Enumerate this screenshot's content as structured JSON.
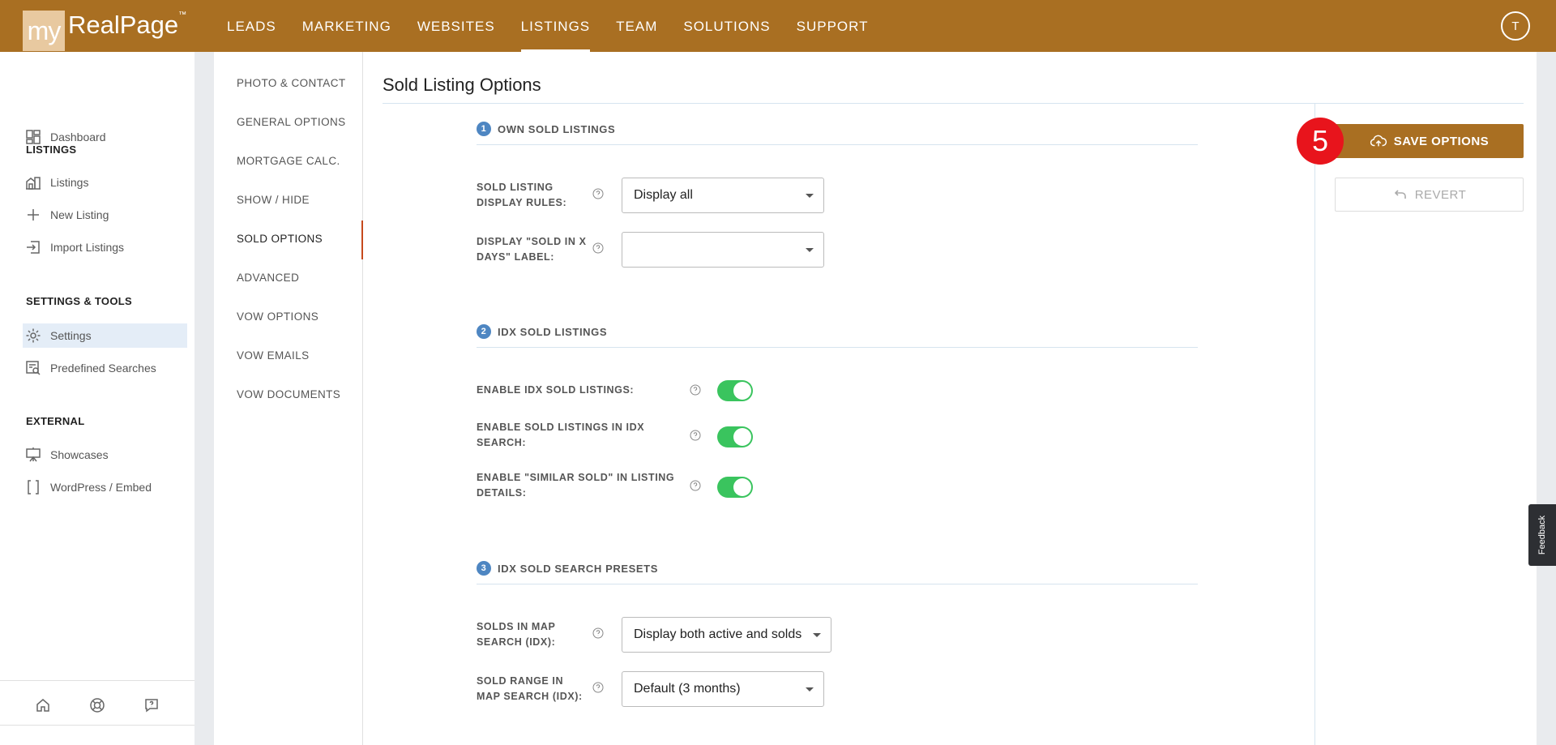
{
  "header": {
    "logo_my": "my",
    "logo_rest": "RealPage",
    "logo_tm": "™",
    "nav": [
      "LEADS",
      "MARKETING",
      "WEBSITES",
      "LISTINGS",
      "TEAM",
      "SOLUTIONS",
      "SUPPORT"
    ],
    "active_nav": "LISTINGS",
    "avatar_initial": "T"
  },
  "sidebar": {
    "dashboard": "Dashboard",
    "listings_title": "LISTINGS",
    "listings": "Listings",
    "new_listing": "New Listing",
    "import_listings": "Import Listings",
    "settings_title": "SETTINGS & TOOLS",
    "settings": "Settings",
    "predefined_searches": "Predefined Searches",
    "external_title": "EXTERNAL",
    "showcases": "Showcases",
    "wordpress": "WordPress / Embed"
  },
  "subnav": {
    "items": [
      "PHOTO & CONTACT",
      "GENERAL OPTIONS",
      "MORTGAGE CALC.",
      "SHOW / HIDE",
      "SOLD OPTIONS",
      "ADVANCED",
      "VOW OPTIONS",
      "VOW EMAILS",
      "VOW DOCUMENTS"
    ],
    "active": "SOLD OPTIONS"
  },
  "main": {
    "title": "Sold Listing Options",
    "section1": {
      "num": "1",
      "title": "OWN SOLD LISTINGS",
      "display_rules_label_1": "SOLD LISTING",
      "display_rules_label_2": "DISPLAY RULES:",
      "display_rules_value": "Display all",
      "sold_days_label_1": "DISPLAY \"SOLD IN X",
      "sold_days_label_2": "DAYS\" LABEL:",
      "sold_days_value": ""
    },
    "section2": {
      "num": "2",
      "title": "IDX SOLD LISTINGS",
      "enable_idx_sold": "ENABLE IDX SOLD LISTINGS:",
      "enable_in_search_1": "ENABLE SOLD LISTINGS IN IDX",
      "enable_in_search_2": "SEARCH:",
      "enable_similar_1": "ENABLE \"SIMILAR SOLD\" IN LISTING",
      "enable_similar_2": "DETAILS:"
    },
    "section3": {
      "num": "3",
      "title": "IDX SOLD SEARCH PRESETS",
      "map_search_label_1": "SOLDS IN MAP",
      "map_search_label_2": "SEARCH (IDX):",
      "map_search_value": "Display both active and solds",
      "range_label_1": "SOLD RANGE IN",
      "range_label_2": "MAP SEARCH (IDX):",
      "range_value": "Default (3 months)"
    },
    "save_label": "SAVE OPTIONS",
    "revert_label": "REVERT",
    "step_badge": "5",
    "feedback": "Feedback"
  },
  "colors": {
    "brand": "#a96f22",
    "toggle_on": "#3ac45e",
    "accent_blue": "#4e86c2",
    "badge_red": "#e8141c"
  }
}
